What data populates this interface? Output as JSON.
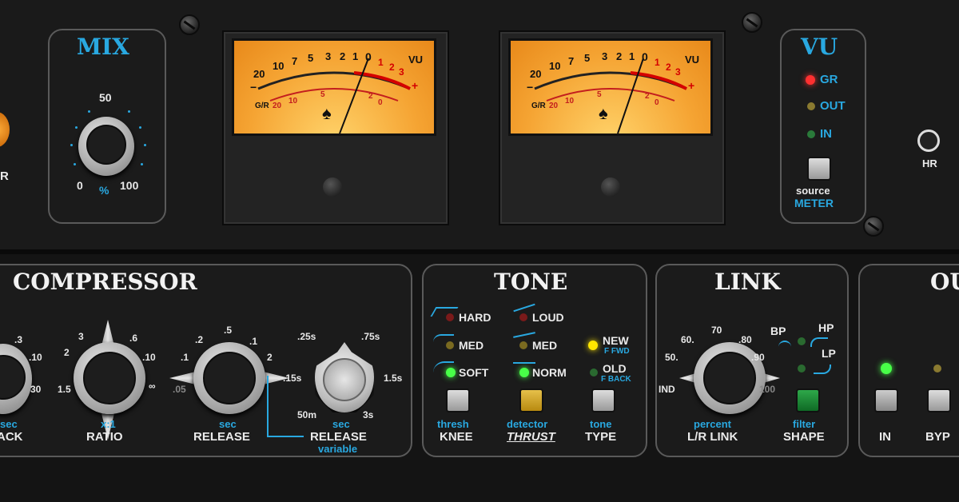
{
  "mix": {
    "title": "MIX",
    "scale_top": "50",
    "scale_left": "0",
    "scale_right": "100",
    "unit": "%",
    "left_partial": "R"
  },
  "meters": {
    "scale": [
      "20",
      "10",
      "7",
      "5",
      "3",
      "2",
      "1",
      "0",
      "1",
      "2",
      "3"
    ],
    "unit": "VU",
    "minus": "−",
    "plus": "+",
    "gr_label": "G/R",
    "gr_scale": [
      "20",
      "10",
      "5",
      "2",
      "0"
    ]
  },
  "vu": {
    "title": "VU",
    "gr": "GR",
    "out": "OUT",
    "in": "IN",
    "source": "source",
    "meter": "METER"
  },
  "hr": {
    "label": "HR"
  },
  "compressor": {
    "title": "COMPRESSOR",
    "attack": {
      "sec": "sec",
      "label": "ACK",
      "ticks": {
        "t1": ".3",
        "t2": ".10",
        "t3": "30"
      }
    },
    "ratio": {
      "sub": "x:1",
      "label": "RATIO",
      "ticks": {
        "t1": "3",
        "t2": ".6",
        "t3": "2",
        "t4": ".10",
        "t5": "1.5",
        "t6": "∞"
      }
    },
    "release": {
      "sub": "sec",
      "label": "RELEASE",
      "ticks": {
        "t1": ".5",
        "t2": ".2",
        "t3": ".1",
        "t4": ".1",
        "t5": "2",
        "t6": ".05"
      }
    },
    "release_var": {
      "sub": "sec",
      "label": "RELEASE",
      "sub2": "variable",
      "ticks": {
        "t1": ".25s",
        "t2": ".75s",
        "t3": ".15s",
        "t4": "1.5s",
        "t5": "50m",
        "t6": "3s"
      }
    }
  },
  "tone": {
    "title": "TONE",
    "knee": {
      "hard": "HARD",
      "med": "MED",
      "soft": "SOFT",
      "sub": "thresh",
      "label": "KNEE"
    },
    "detector": {
      "loud": "LOUD",
      "med": "MED",
      "norm": "NORM",
      "sub": "detector",
      "label": "THRUST"
    },
    "type": {
      "new": "NEW",
      "new_sub": "F FWD",
      "old": "OLD",
      "old_sub": "F BACK",
      "sub": "tone",
      "label": "TYPE"
    }
  },
  "link": {
    "title": "LINK",
    "ticks": {
      "t1": "70",
      "t2": "60.",
      "t3": ".80",
      "t4": "50.",
      "t5": ".90",
      "t6": "IND",
      "t7": "100"
    },
    "sub": "percent",
    "label": "L/R LINK",
    "bp": "BP",
    "hp": "HP",
    "lp": "LP",
    "filter_sub": "filter",
    "filter_label": "SHAPE"
  },
  "output": {
    "title_partial": "OU",
    "in": "IN",
    "byp": "BYP"
  },
  "colors": {
    "accent": "#29a8e0",
    "led_red": "#ff3030",
    "led_green": "#48ff48",
    "led_yellow": "#ffe600",
    "meter_face": "#f5a433"
  }
}
